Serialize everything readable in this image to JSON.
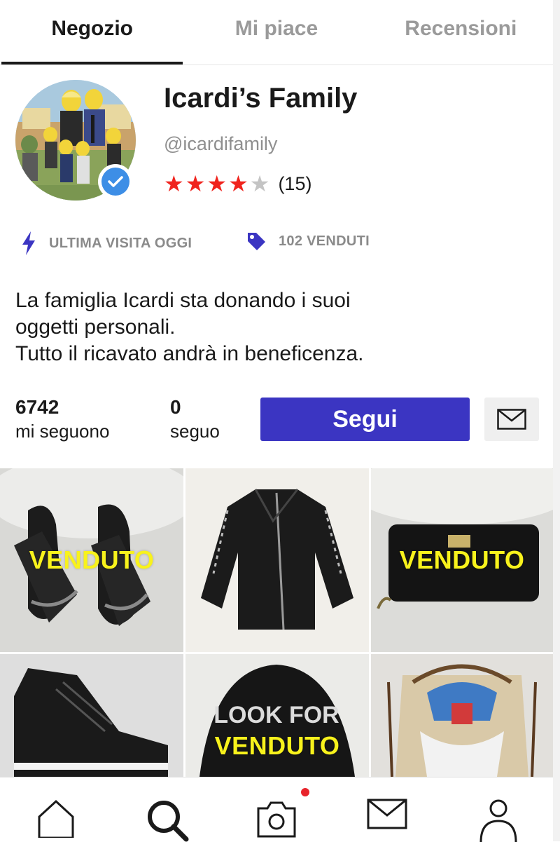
{
  "tabs": [
    {
      "label": "Negozio",
      "active": true
    },
    {
      "label": "Mi piace",
      "active": false
    },
    {
      "label": "Recensioni",
      "active": false
    }
  ],
  "profile": {
    "name": "Icardi’s Family",
    "handle": "@icardifamily",
    "rating_stars": 4,
    "rating_max": 5,
    "rating_count": "(15)",
    "verified": true
  },
  "meta": {
    "last_visit": "ULTIMA VISITA OGGI",
    "sold": "102 VENDUTI"
  },
  "bio": {
    "line1": "La famiglia Icardi sta donando i suoi",
    "line2": "oggetti personali.",
    "line3": "Tutto il ricavato andrà in beneficenza."
  },
  "stats": {
    "followers_count": "6742",
    "followers_label": "mi seguono",
    "following_count": "0",
    "following_label": "seguo"
  },
  "actions": {
    "follow_label": "Segui"
  },
  "items": [
    {
      "name": "scarpe nere con catena",
      "sold_label": "VENDUTO"
    },
    {
      "name": "giacca di pelle nera",
      "sold_label": ""
    },
    {
      "name": "portafoglio nero",
      "sold_label": "VENDUTO"
    },
    {
      "name": "sneakers nere",
      "sold_label": ""
    },
    {
      "name": "cappellino LOOK FOR THE STAR",
      "sold_label": "VENDUTO",
      "print": "LOOK FOR"
    },
    {
      "name": "borsa ricamata",
      "sold_label": ""
    }
  ],
  "bottom_nav": [
    {
      "icon": "home-icon"
    },
    {
      "icon": "search-icon",
      "active": true
    },
    {
      "icon": "camera-icon",
      "notification": true
    },
    {
      "icon": "mail-icon"
    },
    {
      "icon": "profile-icon"
    }
  ],
  "colors": {
    "accent": "#3b35c2",
    "star": "#f0231d",
    "sold_label": "#f8f21c",
    "verified": "#3d8ee6",
    "notification": "#e8242c"
  }
}
